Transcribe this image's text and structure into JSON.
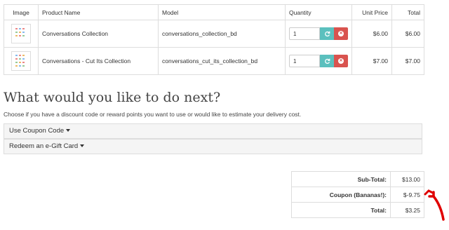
{
  "cart": {
    "headers": {
      "image": "Image",
      "name": "Product Name",
      "model": "Model",
      "quantity": "Quantity",
      "unit_price": "Unit Price",
      "total": "Total"
    },
    "rows": [
      {
        "name": "Conversations Collection",
        "model": "conversations_collection_bd",
        "quantity": "1",
        "unit_price": "$6.00",
        "total": "$6.00",
        "thumb_icon": "product-thumbnail"
      },
      {
        "name": "Conversations - Cut Its Collection",
        "model": "conversations_cut_its_collection_bd",
        "quantity": "1",
        "unit_price": "$7.00",
        "total": "$7.00",
        "thumb_icon": "product-thumbnail"
      }
    ],
    "update_icon": "refresh-icon",
    "remove_icon": "close-circle-icon"
  },
  "next": {
    "heading": "What would you like to do next?",
    "hint": "Choose if you have a discount code or reward points you want to use or would like to estimate your delivery cost.",
    "coupon_label": "Use Coupon Code",
    "gift_label": "Redeem an e-Gift Card"
  },
  "totals": [
    {
      "label": "Sub-Total:",
      "value": "$13.00"
    },
    {
      "label": "Coupon (Bananas!):",
      "value": "$-9.75"
    },
    {
      "label": "Total:",
      "value": "$3.25"
    }
  ],
  "colors": {
    "update_button": "#5bc0be",
    "remove_button": "#d9534f",
    "annotation_arrow": "#e00000"
  }
}
